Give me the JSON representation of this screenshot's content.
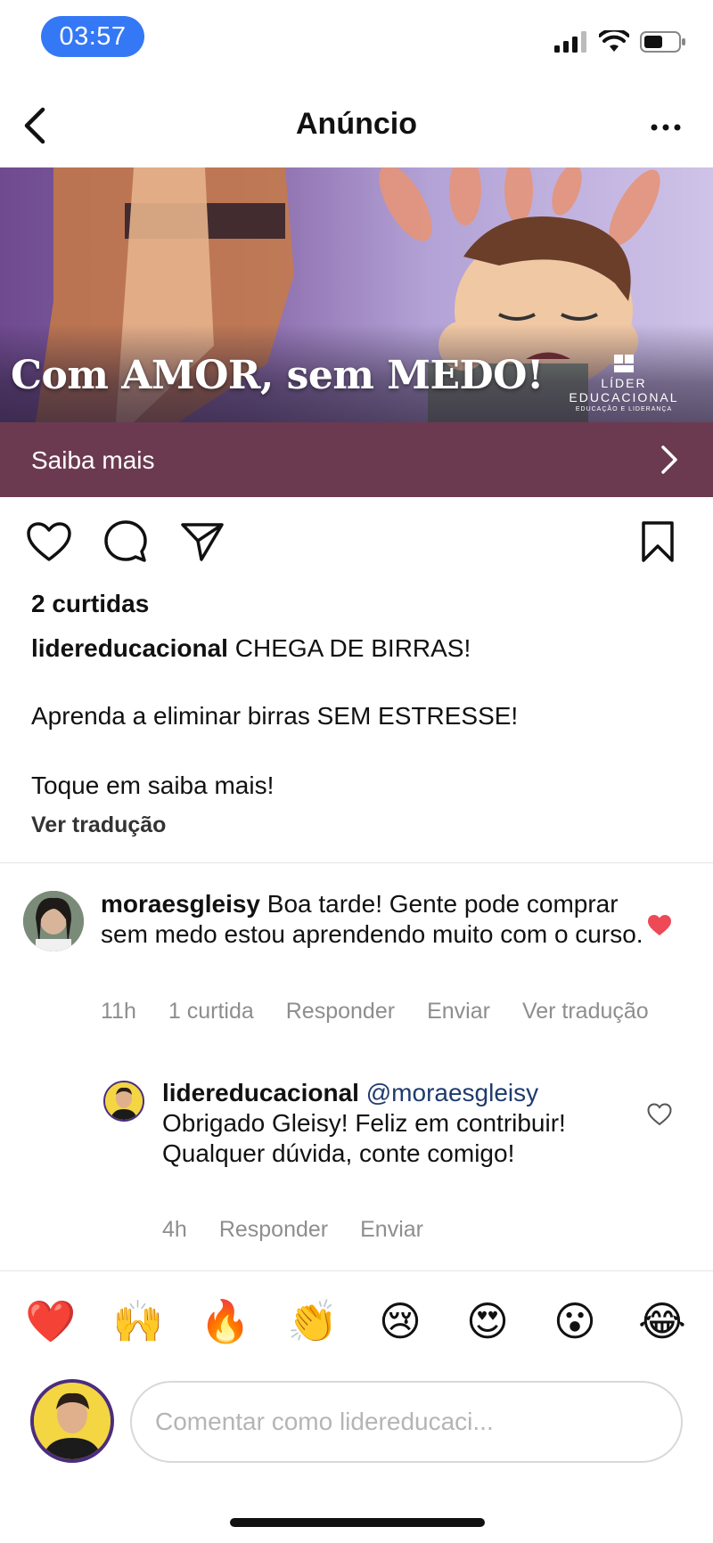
{
  "status_bar": {
    "time": "03:57"
  },
  "header": {
    "title": "Anúncio"
  },
  "banner": {
    "headline": "Com AMOR, sem MEDO!",
    "brand_name": "LÍDER EDUCACIONAL",
    "brand_tagline": "EDUCAÇÃO E LIDERANÇA"
  },
  "cta": {
    "label": "Saiba mais"
  },
  "post": {
    "likes": "2 curtidas",
    "caption_user": "lidereducacional",
    "caption_line1": "CHEGA DE BIRRAS!",
    "caption_line2": "Aprenda a eliminar birras SEM ESTRESSE!",
    "caption_line3": "Toque em saiba mais!",
    "translate": "Ver tradução"
  },
  "comments": [
    {
      "user": "moraesgleisy",
      "text": "Boa tarde! Gente pode comprar sem medo estou aprendendo muito com o curso.",
      "time": "11h",
      "likes": "1 curtida",
      "reply": "Responder",
      "send": "Enviar",
      "translate": "Ver tradução",
      "liked": true
    },
    {
      "user": "lidereducacional",
      "mention": "@moraesgleisy",
      "text": "Obrigado Gleisy! Feliz em contribuir! Qualquer dúvida, conte comigo!",
      "time": "4h",
      "reply": "Responder",
      "send": "Enviar",
      "liked": false
    }
  ],
  "emoji_bar": [
    "❤️",
    "🙌",
    "🔥",
    "👏",
    "😢",
    "😍",
    "😮",
    "😂"
  ],
  "comment_input": {
    "placeholder": "Comentar como lidereducaci..."
  },
  "colors": {
    "accent": "#3478f6",
    "cta_background": "#6b3a50",
    "liked_heart": "#ed4956",
    "avatar_ring": "#4b2d7f"
  }
}
